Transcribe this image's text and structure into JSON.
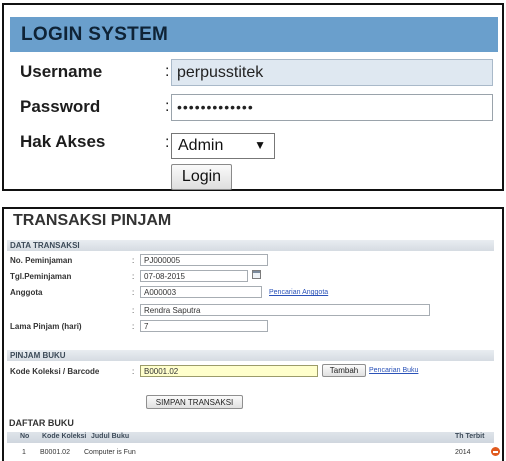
{
  "login": {
    "title": "LOGIN SYSTEM",
    "username_label": "Username",
    "username_value": "perpusstitek",
    "password_label": "Password",
    "password_value": "•••••••••••••",
    "access_label": "Hak Akses",
    "access_value": "Admin",
    "colon": ":",
    "login_button": "Login"
  },
  "transaksi": {
    "title": "TRANSAKSI PINJAM",
    "data_section": "DATA TRANSAKSI",
    "fields": {
      "no_label": "No. Peminjaman",
      "no_value": "PJ000005",
      "tgl_label": "Tgl.Peminjaman",
      "tgl_value": "07-08-2015",
      "anggota_label": "Anggota",
      "anggota_value": "A000003",
      "anggota_link": "Pencarian Anggota",
      "nama_value": "Rendra Saputra",
      "lama_label": "Lama Pinjam (hari)",
      "lama_value": "7"
    },
    "pinjam_section": "PINJAM BUKU",
    "kode_label": "Kode Koleksi / Barcode",
    "kode_value": "B0001.02",
    "tambah_button": "Tambah",
    "buku_link": "Pencarian Buku",
    "simpan_button": "SIMPAN TRANSAKSI",
    "colon": ":",
    "daftar_title": "DAFTAR BUKU",
    "table": {
      "headers": [
        "No",
        "Kode Koleksi",
        "Judul Buku",
        "Th Terbit"
      ],
      "rows": [
        [
          "1",
          "B0001.02",
          "Computer is Fun",
          "2014"
        ]
      ]
    }
  },
  "icons": [
    "calendar-icon",
    "delete-icon",
    "chevron-down-icon"
  ],
  "colors": {
    "login_header": "#6a9fcc",
    "link": "#2a52b8",
    "highlight_input": "#ffffcc",
    "delete": "#e05a1e"
  }
}
